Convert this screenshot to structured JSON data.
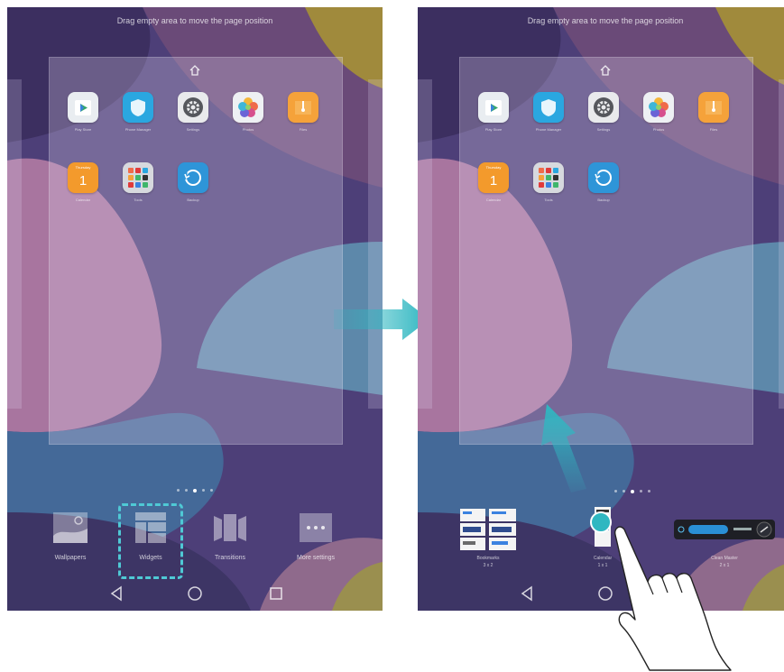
{
  "hint_text": "Drag empty area to move the page position",
  "apps": [
    {
      "label": "Play Store",
      "icon": "play-store-icon",
      "color": "#e9edf1"
    },
    {
      "label": "Phone Manager",
      "icon": "phone-manager-icon",
      "color": "#2aa7e0"
    },
    {
      "label": "Settings",
      "icon": "settings-icon",
      "color": "#e9eaec"
    },
    {
      "label": "Photos",
      "icon": "photos-icon",
      "color": "#eef0f3"
    },
    {
      "label": "Files",
      "icon": "files-icon",
      "color": "#f5a23a"
    },
    {
      "label": "Calendar",
      "icon": "calendar-icon",
      "color": "#f39a2c",
      "day": "Thursday",
      "date": "1"
    },
    {
      "label": "Tools",
      "icon": "tools-folder-icon",
      "color": "#d7d9de"
    },
    {
      "label": "Backup",
      "icon": "backup-icon",
      "color": "#2e95d8"
    }
  ],
  "left": {
    "options": [
      {
        "label": "Wallpapers",
        "icon": "wallpapers-icon"
      },
      {
        "label": "Widgets",
        "icon": "widgets-icon"
      },
      {
        "label": "Transitions",
        "icon": "transitions-icon"
      },
      {
        "label": "More settings",
        "icon": "more-settings-icon"
      }
    ]
  },
  "right": {
    "widgets": [
      {
        "label": "Bookmarks",
        "size": "3 x 2"
      },
      {
        "label": "Calendar",
        "size": "1 x 1"
      },
      {
        "label": "Clean Master",
        "size": "2 x 1"
      }
    ]
  },
  "colors": {
    "accent": "#4fc9d5",
    "arrow": "#2fb7c1",
    "wallpaper_top": "#3f3566",
    "wallpaper_bottom": "#5c4784"
  }
}
